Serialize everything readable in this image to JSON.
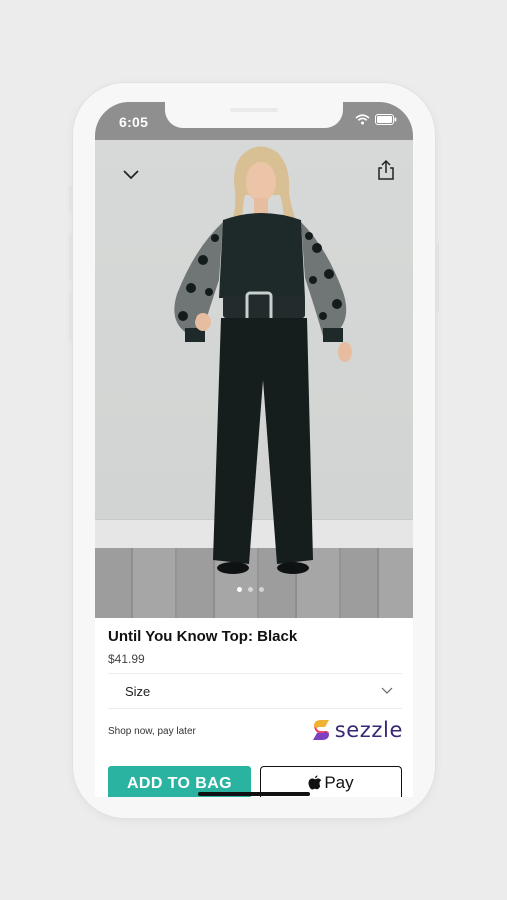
{
  "status_bar": {
    "time": "6:05",
    "icons": [
      "wifi-icon",
      "battery-icon"
    ]
  },
  "hero": {
    "icons": [
      "chevron-down-icon",
      "share-icon"
    ],
    "carousel_count": 3,
    "carousel_active": 1
  },
  "product": {
    "name": "Until You Know Top: Black",
    "price": "$41.99"
  },
  "size": {
    "label": "Size"
  },
  "payment": {
    "tagline": "Shop now, pay later",
    "provider": "sezzle",
    "provider_color": "#382876"
  },
  "actions": {
    "add_to_bag": "ADD TO BAG",
    "apple_pay": "Pay"
  },
  "colors": {
    "accent": "#2bb3a2",
    "status_bar": "#8f8f8f"
  }
}
